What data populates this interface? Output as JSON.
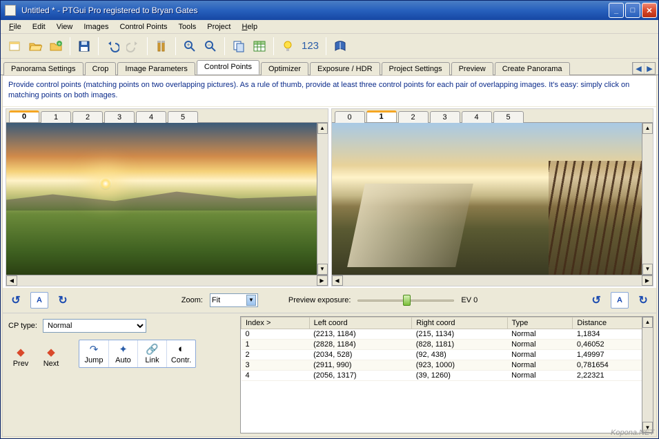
{
  "window": {
    "title": "Untitled * - PTGui Pro registered to Bryan Gates"
  },
  "menus": {
    "file": "File",
    "edit": "Edit",
    "view": "View",
    "images": "Images",
    "controlpoints": "Control Points",
    "tools": "Tools",
    "project": "Project",
    "help": "Help"
  },
  "toolbar": {
    "num": "123"
  },
  "tabs": {
    "panorama": "Panorama Settings",
    "crop": "Crop",
    "imgparams": "Image Parameters",
    "controlpoints": "Control Points",
    "optimizer": "Optimizer",
    "exposure": "Exposure / HDR",
    "projectsettings": "Project Settings",
    "preview": "Preview",
    "create": "Create Panorama"
  },
  "instruction": "Provide control points (matching points on two overlapping pictures). As a rule of thumb, provide at least three control points for each pair of overlapping images. It's easy: simply click on matching points on both images.",
  "imgtabs": [
    "0",
    "1",
    "2",
    "3",
    "4",
    "5"
  ],
  "left_active": "0",
  "right_active": "1",
  "mid": {
    "zoom_label": "Zoom:",
    "zoom_value": "Fit",
    "preview_label": "Preview exposure:",
    "ev": "EV 0"
  },
  "cp": {
    "label": "CP type:",
    "value": "Normal"
  },
  "nav": {
    "prev": "Prev",
    "next": "Next",
    "jump": "Jump",
    "auto": "Auto",
    "link": "Link",
    "contr": "Contr."
  },
  "table": {
    "headers": {
      "index": "Index >",
      "left": "Left coord",
      "right": "Right coord",
      "type": "Type",
      "dist": "Distance"
    },
    "rows": [
      {
        "index": "0",
        "left": "(2213, 1184)",
        "right": "(215, 1134)",
        "type": "Normal",
        "dist": "1,1834"
      },
      {
        "index": "1",
        "left": "(2828, 1184)",
        "right": "(828, 1181)",
        "type": "Normal",
        "dist": "0,46052"
      },
      {
        "index": "2",
        "left": "(2034, 528)",
        "right": "(92, 438)",
        "type": "Normal",
        "dist": "1,49997"
      },
      {
        "index": "3",
        "left": "(2911, 990)",
        "right": "(923, 1000)",
        "type": "Normal",
        "dist": "0,781654"
      },
      {
        "index": "4",
        "left": "(2056, 1317)",
        "right": "(39, 1260)",
        "type": "Normal",
        "dist": "2,22321"
      }
    ]
  },
  "watermark": "Kopona.NET"
}
